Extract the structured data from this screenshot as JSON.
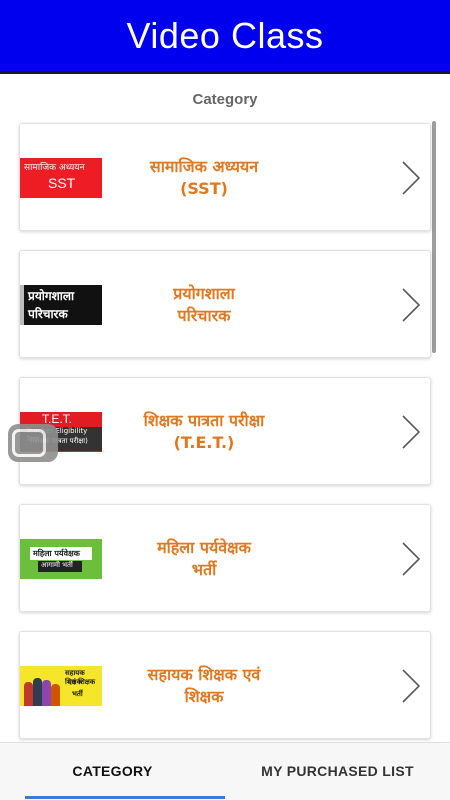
{
  "header": {
    "title": "Video Class",
    "bg_color": "#0000ee"
  },
  "category_label": "Category",
  "categories": [
    {
      "title_line1": "सामाजिक अध्ययन",
      "title_line2": "(SST)",
      "thumb_text1": "सामाजिक अध्ययन",
      "thumb_text2": "SST"
    },
    {
      "title_line1": "प्रयोगशाला",
      "title_line2": "परिचारक",
      "thumb_text1": "प्रयोगशाला",
      "thumb_text2": "परिचारक"
    },
    {
      "title_line1": "शिक्षक पात्रता परीक्षा",
      "title_line2": "(T.E.T.)",
      "thumb_text1": "T.E.T.",
      "thumb_text2": "Teacher Eligibility Test",
      "thumb_text3": "(शिक्षक पात्रता परीक्षा)"
    },
    {
      "title_line1": "महिला पर्यवेक्षक",
      "title_line2": "भर्ती",
      "thumb_text1": "महिला पर्यवेक्षक",
      "thumb_text2": "आगामी भर्ती"
    },
    {
      "title_line1": "सहायक शिक्षक एवं",
      "title_line2": "शिक्षक",
      "thumb_text1": "सहायक शिक्षक",
      "thumb_text2": "एवं शिक्षक",
      "thumb_text3": "भर्ती"
    }
  ],
  "bottom_nav": {
    "tabs": [
      "CATEGORY",
      "MY PURCHASED LIST"
    ],
    "active_tab": "CATEGORY",
    "indicator_color": "#3a7bd5"
  },
  "colors": {
    "title_orange": "#e07820",
    "sst_red": "#ee1c24",
    "tet_red": "#e31b23",
    "mahila_green": "#6cbf3c",
    "sahayak_yellow": "#f6e62a"
  },
  "icons": {
    "chevron": "chevron-right-icon",
    "floating": "overlay-window-icon"
  }
}
